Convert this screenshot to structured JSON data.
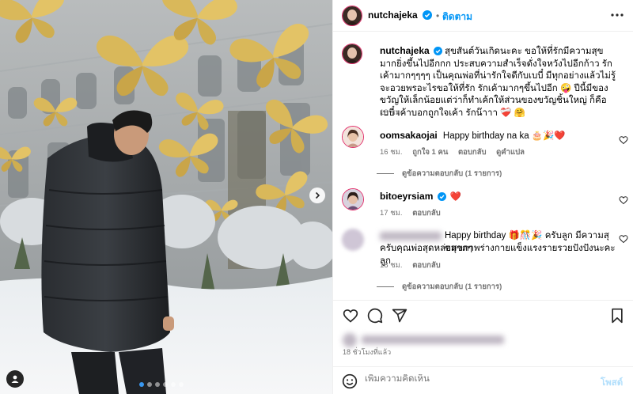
{
  "post": {
    "author": "nutchajeka",
    "follow_label": "ติดตาม",
    "more_icon": "more-horizontal-icon",
    "photo_alt": "man in black puffer jacket standing in snow before building with golden butterflies",
    "carousel_dots": 6,
    "carousel_active_index": 0
  },
  "caption": {
    "username": "nutchajeka",
    "text": "สุขสันต์วันเกิดนะคะ ขอให้ที่รักมีความสุขมากยิ่งขึ้นไปอีกกก ประสบความสำเร็จดั่งใจหวังไปอีกก้าว รักเค้ามากๆๆๆๆ เป็นคุณพ่อที่น่ารักใจดีกับเบบี๋ มีทุกอย่างแล้วไม่รู้จะอวยพรอะไรขอให้ที่รัก รักเค้ามากๆขึ้นไปอีก 🤪 ปีนี้มีของขวัญให้เล็กน้อยแต่ว่าก็ทำเค้กให้ส่วนของขวัญชิ้นใหญ่ ก็คือเบบี๋ เค้าบอกถูกใจเค้า รักน๊าาา ❤️‍🩹 🤗",
    "time": "18 ชม."
  },
  "comments": [
    {
      "username": "oomsakaojai",
      "text": "Happy birthday na ka 🎂🎉❤️",
      "time": "16 ชม.",
      "likes": "ถูกใจ 1 คน",
      "reply_label": "ตอบกลับ",
      "translate_label": "ดูคำแปล",
      "view_replies": "ดูข้อความตอบกลับ (1 รายการ)"
    },
    {
      "username": "bitoeyrsiam",
      "text": "❤️",
      "time": "17 ชม.",
      "reply_label": "ตอบกลับ"
    },
    {
      "username": "",
      "text_line1": "Happy birthday 🎁🎊🎉 ครับลูก มีความสุขมากๆ",
      "text_line2": "ครับคุณพ่อสุดหล่อสุขภาพร่างกายแข็งแรงรายรวยปังปังนะคะลูก",
      "time": "18 ชม.",
      "reply_label": "ตอบกลับ",
      "view_replies": "ดูข้อความตอบกลับ (1 รายการ)"
    }
  ],
  "actions": {
    "like_icon": "heart-icon",
    "comment_icon": "comment-icon",
    "share_icon": "send-icon",
    "save_icon": "bookmark-icon",
    "timestamp": "18 ชั่วโมงที่แล้ว"
  },
  "add_comment": {
    "placeholder": "เพิ่มความคิดเห็น",
    "post_label": "โพสต์",
    "emoji_icon": "emoji-icon"
  },
  "colors": {
    "link_blue": "#0095f6",
    "verified_blue": "#0095f6",
    "post_disabled": "#b2dffc",
    "meta_grey": "#737373"
  }
}
